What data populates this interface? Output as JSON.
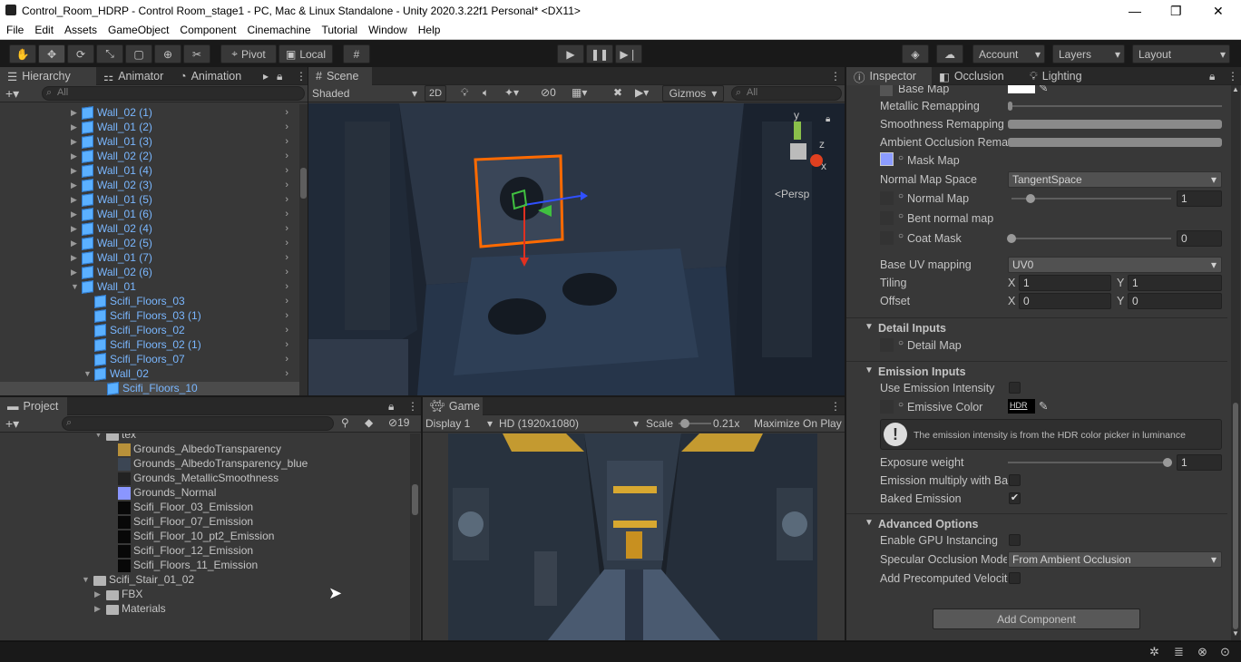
{
  "window": {
    "title": "Control_Room_HDRP - Control Room_stage1 - PC, Mac & Linux Standalone - Unity 2020.3.22f1 Personal* <DX11>",
    "minimize": "—",
    "restore": "❐",
    "close": "✕"
  },
  "menu": [
    "File",
    "Edit",
    "Assets",
    "GameObject",
    "Component",
    "Cinemachine",
    "Tutorial",
    "Window",
    "Help"
  ],
  "toolbar": {
    "pivot": "Pivot",
    "local": "Local",
    "account": "Account",
    "layers": "Layers",
    "layout": "Layout"
  },
  "hierarchy": {
    "tabs": [
      "Hierarchy",
      "Animator",
      "Animation"
    ],
    "search_placeholder": "All",
    "items": [
      {
        "label": "Wall_02 (1)",
        "depth": 0,
        "expanded": false
      },
      {
        "label": "Wall_01 (2)",
        "depth": 0,
        "expanded": false
      },
      {
        "label": "Wall_01 (3)",
        "depth": 0,
        "expanded": false
      },
      {
        "label": "Wall_02 (2)",
        "depth": 0,
        "expanded": false
      },
      {
        "label": "Wall_01 (4)",
        "depth": 0,
        "expanded": false
      },
      {
        "label": "Wall_02 (3)",
        "depth": 0,
        "expanded": false
      },
      {
        "label": "Wall_01 (5)",
        "depth": 0,
        "expanded": false
      },
      {
        "label": "Wall_01 (6)",
        "depth": 0,
        "expanded": false
      },
      {
        "label": "Wall_02 (4)",
        "depth": 0,
        "expanded": false
      },
      {
        "label": "Wall_02 (5)",
        "depth": 0,
        "expanded": false
      },
      {
        "label": "Wall_01 (7)",
        "depth": 0,
        "expanded": false
      },
      {
        "label": "Wall_02 (6)",
        "depth": 0,
        "expanded": false
      },
      {
        "label": "Wall_01",
        "depth": 0,
        "expanded": true
      },
      {
        "label": "Scifi_Floors_03",
        "depth": 1,
        "expanded": null
      },
      {
        "label": "Scifi_Floors_03 (1)",
        "depth": 1,
        "expanded": null
      },
      {
        "label": "Scifi_Floors_02",
        "depth": 1,
        "expanded": null
      },
      {
        "label": "Scifi_Floors_02 (1)",
        "depth": 1,
        "expanded": null
      },
      {
        "label": "Scifi_Floors_07",
        "depth": 1,
        "expanded": null
      },
      {
        "label": "Wall_02",
        "depth": 1,
        "expanded": true
      },
      {
        "label": "Scifi_Floors_10",
        "depth": 2,
        "expanded": null
      }
    ]
  },
  "scene": {
    "tab": "Scene",
    "shading": "Shaded",
    "mode2d": "2D",
    "hidden_count": "0",
    "gizmos": "Gizmos",
    "search_placeholder": "All",
    "persp": "<Persp",
    "axis_y": "y",
    "axis_z": "z",
    "axis_x": "x"
  },
  "project": {
    "tab": "Project",
    "hidden_count": "19",
    "items": [
      {
        "label": "tex",
        "indent": 1,
        "kind": "folder-open"
      },
      {
        "label": "Grounds_AlbedoTransparency",
        "indent": 2,
        "kind": "tex-albedo"
      },
      {
        "label": "Grounds_AlbedoTransparency_blue",
        "indent": 2,
        "kind": "tex-blue"
      },
      {
        "label": "Grounds_MetallicSmoothness",
        "indent": 2,
        "kind": "tex-metal"
      },
      {
        "label": "Grounds_Normal",
        "indent": 2,
        "kind": "tex-normal"
      },
      {
        "label": "Scifi_Floor_03_Emission",
        "indent": 2,
        "kind": "tex-black"
      },
      {
        "label": "Scifi_Floor_07_Emission",
        "indent": 2,
        "kind": "tex-black"
      },
      {
        "label": "Scifi_Floor_10_pt2_Emission",
        "indent": 2,
        "kind": "tex-black"
      },
      {
        "label": "Scifi_Floor_12_Emission",
        "indent": 2,
        "kind": "tex-black"
      },
      {
        "label": "Scifi_Floors_11_Emission",
        "indent": 2,
        "kind": "tex-black"
      },
      {
        "label": "Scifi_Stair_01_02",
        "indent": 0,
        "kind": "folder-open"
      },
      {
        "label": "FBX",
        "indent": 1,
        "kind": "folder"
      },
      {
        "label": "Materials",
        "indent": 1,
        "kind": "folder"
      }
    ]
  },
  "game": {
    "tab": "Game",
    "display": "Display 1",
    "resolution": "HD (1920x1080)",
    "scale_label": "Scale",
    "scale_value": "0.21x",
    "maximize": "Maximize On Play"
  },
  "inspector": {
    "tabs": [
      "Inspector",
      "Occlusion",
      "Lighting"
    ],
    "base_map": "Base Map",
    "metallic_remap": "Metallic Remapping",
    "smooth_remap": "Smoothness Remapping",
    "ao_remap": "Ambient Occlusion Rema",
    "mask_map": "Mask Map",
    "normal_space_label": "Normal Map Space",
    "normal_space_value": "TangentSpace",
    "normal_map": "Normal Map",
    "normal_map_value": "1",
    "bent_normal": "Bent normal map",
    "coat_mask": "Coat Mask",
    "coat_mask_value": "0",
    "base_uv_label": "Base UV mapping",
    "base_uv_value": "UV0",
    "tiling_label": "Tiling",
    "tiling_x": "1",
    "tiling_y": "1",
    "offset_label": "Offset",
    "offset_x": "0",
    "offset_y": "0",
    "x": "X",
    "y": "Y",
    "detail_header": "Detail Inputs",
    "detail_map": "Detail Map",
    "emission_header": "Emission Inputs",
    "use_emission_intensity": "Use Emission Intensity",
    "emissive_color": "Emissive Color",
    "hdr": "HDR",
    "emission_note": "The emission intensity is from the HDR color picker in luminance",
    "exposure_weight": "Exposure weight",
    "exposure_value": "1",
    "emission_multiply": "Emission multiply with Ba",
    "baked_emission": "Baked Emission",
    "advanced_header": "Advanced Options",
    "gpu_instancing": "Enable GPU Instancing",
    "specular_occlusion_label": "Specular Occlusion Mode",
    "specular_occlusion_value": "From Ambient Occlusion",
    "precomputed_velocity": "Add Precomputed Velocit",
    "add_component": "Add Component"
  },
  "colors": {
    "accent_blue": "#7ab7ff",
    "selection_orange": "#ff6a00",
    "panel_bg": "#383838",
    "tab_bg": "#282828"
  }
}
